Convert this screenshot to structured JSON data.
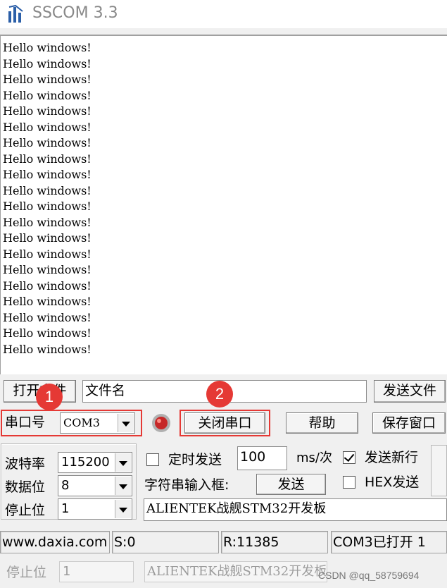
{
  "window": {
    "title": "SSCOM 3.3"
  },
  "receive": {
    "lines": [
      "Hello windows!",
      "Hello windows!",
      "Hello windows!",
      "Hello windows!",
      "Hello windows!",
      "Hello windows!",
      "Hello windows!",
      "Hello windows!",
      "Hello windows!",
      "Hello windows!",
      "Hello windows!",
      "Hello windows!",
      "Hello windows!",
      "Hello windows!",
      "Hello windows!",
      "Hello windows!",
      "Hello windows!",
      "Hello windows!",
      "Hello windows!",
      "Hello windows!"
    ]
  },
  "file_row": {
    "open_file_label": "打开文件",
    "file_name_value": "文件名",
    "send_file_label": "发送文件"
  },
  "port_row": {
    "port_label": "串口号",
    "port_value": "COM3",
    "close_port_label": "关闭串口",
    "help_label": "帮助",
    "save_window_label": "保存窗口"
  },
  "settings": {
    "baud_label": "波特率",
    "baud_value": "115200",
    "data_bits_label": "数据位",
    "data_bits_value": "8",
    "stop_bits_label": "停止位",
    "stop_bits_value": "1"
  },
  "send": {
    "timed_send_label": "定时发送",
    "timed_send_checked": false,
    "interval_value": "100",
    "interval_unit": "ms/次",
    "send_newline_label": "发送新行",
    "send_newline_checked": true,
    "string_input_label": "字符串输入框:",
    "send_button_label": "发送",
    "hex_send_label": "HEX发送",
    "hex_send_checked": false,
    "input_value": "ALIENTEK战舰STM32开发板"
  },
  "status_bar": {
    "website": "www.daxia.com",
    "sent_count": "S:0",
    "received_count": "R:11385",
    "port_status": "COM3已打开  1"
  },
  "annotations": {
    "badge_1": "1",
    "badge_2": "2",
    "accent_color": "#e53935"
  },
  "ghost_row": {
    "stop_bits_label": "停止位",
    "stop_bits_value": "1",
    "input_value": "ALIENTEK战舰STM32开发板"
  },
  "watermark": {
    "text": "CSDN @qq_58759694"
  }
}
